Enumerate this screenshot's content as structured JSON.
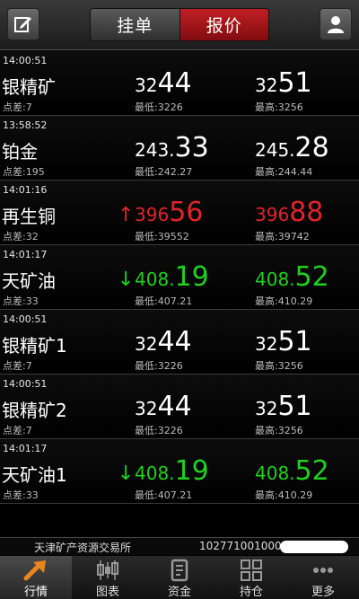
{
  "header": {
    "edit_icon": "edit-icon",
    "user_icon": "user-icon",
    "tabs": [
      {
        "label": "挂单",
        "active": false
      },
      {
        "label": "报价",
        "active": true
      }
    ]
  },
  "colors": {
    "up": "#e3222a",
    "down": "#1fd11f",
    "neutral": "#ffffff",
    "active_tab": "#b3161b"
  },
  "rows": [
    {
      "time": "14:00:51",
      "name": "银精矿",
      "spread": "点差:7",
      "bid_prefix": "32",
      "bid_big": "44",
      "ask_prefix": "32",
      "ask_big": "51",
      "low": "最低:3226",
      "high": "最高:3256",
      "trend": "none",
      "arrow": ""
    },
    {
      "time": "13:58:52",
      "name": "铂金",
      "spread": "点差:195",
      "bid_prefix": "243.",
      "bid_big": "33",
      "ask_prefix": "245.",
      "ask_big": "28",
      "low": "最低:242.27",
      "high": "最高:244.44",
      "trend": "none",
      "arrow": ""
    },
    {
      "time": "14:01:16",
      "name": "再生铜",
      "spread": "点差:32",
      "bid_prefix": "396",
      "bid_big": "56",
      "ask_prefix": "396",
      "ask_big": "88",
      "low": "最低:39552",
      "high": "最高:39742",
      "trend": "up",
      "arrow": "↑"
    },
    {
      "time": "14:01:17",
      "name": "天矿油",
      "spread": "点差:33",
      "bid_prefix": "408.",
      "bid_big": "19",
      "ask_prefix": "408.",
      "ask_big": "52",
      "low": "最低:407.21",
      "high": "最高:410.29",
      "trend": "down",
      "arrow": "↓"
    },
    {
      "time": "14:00:51",
      "name": "银精矿1",
      "spread": "点差:7",
      "bid_prefix": "32",
      "bid_big": "44",
      "ask_prefix": "32",
      "ask_big": "51",
      "low": "最低:3226",
      "high": "最高:3256",
      "trend": "none",
      "arrow": ""
    },
    {
      "time": "14:00:51",
      "name": "银精矿2",
      "spread": "点差:7",
      "bid_prefix": "32",
      "bid_big": "44",
      "ask_prefix": "32",
      "ask_big": "51",
      "low": "最低:3226",
      "high": "最高:3256",
      "trend": "none",
      "arrow": ""
    },
    {
      "time": "14:01:17",
      "name": "天矿油1",
      "spread": "点差:33",
      "bid_prefix": "408.",
      "bid_big": "19",
      "ask_prefix": "408.",
      "ask_big": "52",
      "low": "最低:407.21",
      "high": "最高:410.29",
      "trend": "down",
      "arrow": "↓"
    }
  ],
  "status": {
    "exchange": "天津矿产资源交易所",
    "account": "102771001000"
  },
  "tabbar": [
    {
      "label": "行情",
      "icon": "market-arrow-icon",
      "active": true
    },
    {
      "label": "图表",
      "icon": "candlestick-chart-icon",
      "active": false
    },
    {
      "label": "资金",
      "icon": "funds-document-icon",
      "active": false
    },
    {
      "label": "持仓",
      "icon": "positions-grid-icon",
      "active": false
    },
    {
      "label": "更多",
      "icon": "more-dots-icon",
      "active": false
    }
  ]
}
